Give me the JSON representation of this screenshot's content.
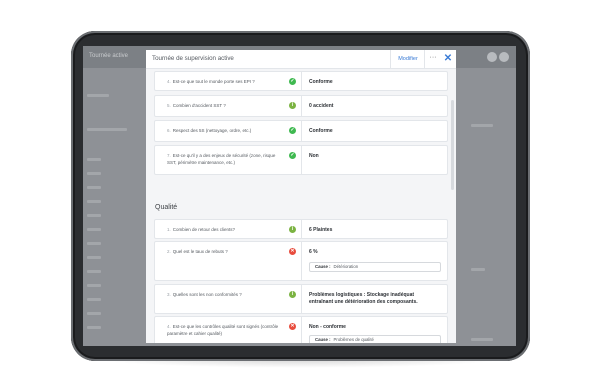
{
  "modal": {
    "title": "Tournée de supervision active",
    "edit_label": "Modifier",
    "more_label": "···",
    "close_label": "✕",
    "section_label": "Qualité",
    "rows": [
      {
        "num": "4.",
        "question": "Est-ce que tout le monde porte ses EPI ?",
        "status": "ok",
        "answer": "Conforme"
      },
      {
        "num": "5.",
        "question": "Combien d'accident SST ?",
        "status": "warn",
        "answer": "0 accident"
      },
      {
        "num": "6.",
        "question": "Respect des 5S (nettoyage, ordre, etc.)",
        "status": "ok",
        "answer": "Conforme"
      },
      {
        "num": "7.",
        "question": "Est-ce qu'il y a des enjeux de sécurité (zone, risque SST, périmètre maintenance, etc.)",
        "status": "ok",
        "answer": "Non"
      },
      {
        "num": "1.",
        "question": "Combien de retour des clients?",
        "status": "warn",
        "answer": "6 Plaintes"
      },
      {
        "num": "2.",
        "question": "Quel est le taux de rebuts ?",
        "status": "err",
        "answer": "6 %",
        "cause_label": "Cause :",
        "cause_value": "Détérioration"
      },
      {
        "num": "3.",
        "question": "Quelles sont les non conformités ?",
        "status": "warn",
        "answer": "Problèmes logistiques : Stockage inadéquat entraînant une détérioration des composants."
      },
      {
        "num": "4.",
        "question": "Est-ce que les contrôles qualité sont signés (contrôle paramètre et cahier qualité)",
        "status": "err",
        "answer": "Non - conforme",
        "cause_label": "Cause :",
        "cause_value": "Problèmes de qualité"
      }
    ]
  },
  "background": {
    "title": "Tournée active"
  },
  "colors": {
    "accent": "#3a7bd5",
    "ok": "#3fb950",
    "warn": "#7bb342",
    "error": "#e84c3d"
  },
  "icons": {
    "ok": "check-circle-icon",
    "warn": "info-circle-icon",
    "err": "x-circle-icon"
  }
}
